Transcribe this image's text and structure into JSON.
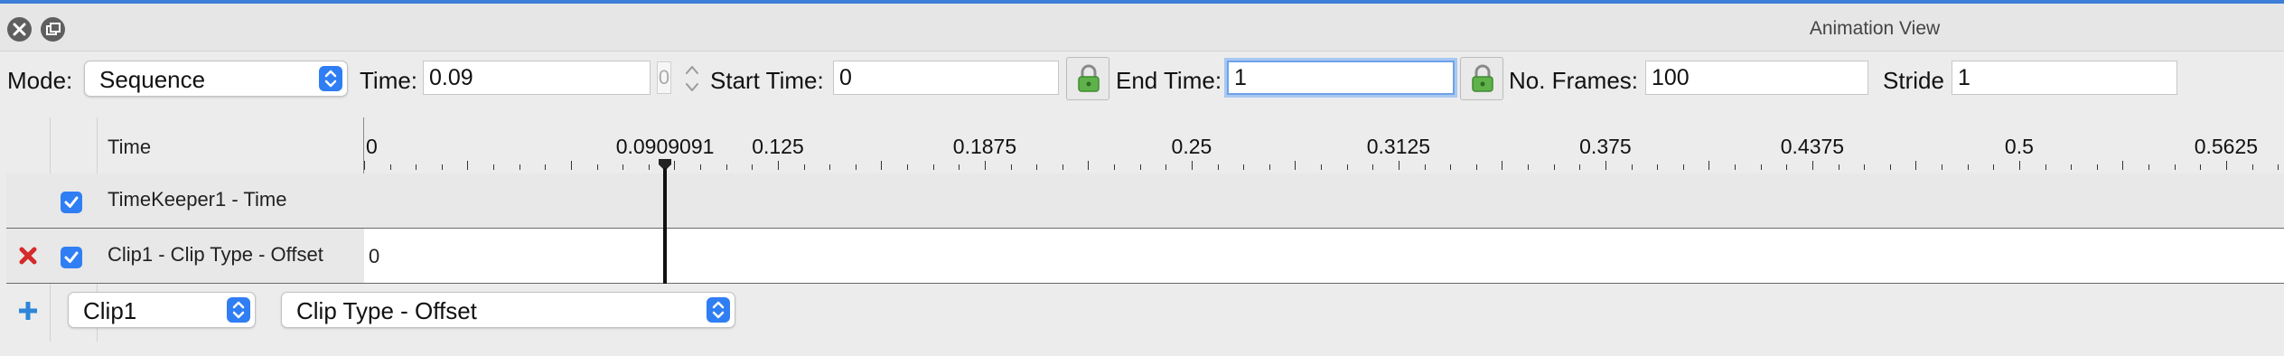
{
  "window": {
    "title": "Animation View",
    "close_icon": "close-circle-icon",
    "float_icon": "float-window-icon"
  },
  "toolbar": {
    "mode_label": "Mode:",
    "mode_value": "Sequence",
    "time_label": "Time:",
    "time_value": "0.09",
    "time_index_value": "0",
    "start_time_label": "Start Time:",
    "start_time_value": "0",
    "end_time_label": "End Time:",
    "end_time_value": "1",
    "frames_label": "No. Frames:",
    "frames_value": "100",
    "stride_label": "Stride",
    "stride_value": "1",
    "lock_icon": "lock-icon",
    "accent_color": "#2f7ef3",
    "focus_color": "#6ea2e8"
  },
  "timeline": {
    "header_label": "Time",
    "tick_labels": [
      "0",
      "0.0909091",
      "0.125",
      "0.1875",
      "0.25",
      "0.3125",
      "0.375",
      "0.4375",
      "0.5",
      "0.5625"
    ],
    "tick_values": [
      0,
      0.0909091,
      0.125,
      0.1875,
      0.25,
      0.3125,
      0.375,
      0.4375,
      0.5,
      0.5625
    ],
    "visible_range": [
      0,
      0.58
    ],
    "current_time": 0.0909091
  },
  "tracks": [
    {
      "name": "TimeKeeper1 - Time",
      "checked": true,
      "deletable": false,
      "keyframe_text": ""
    },
    {
      "name": "Clip1 - Clip Type - Offset",
      "checked": true,
      "deletable": true,
      "keyframe_text": "0"
    }
  ],
  "add_track": {
    "source_value": "Clip1",
    "property_value": "Clip Type - Offset",
    "add_icon": "plus-icon",
    "delete_icon": "delete-x-icon"
  }
}
